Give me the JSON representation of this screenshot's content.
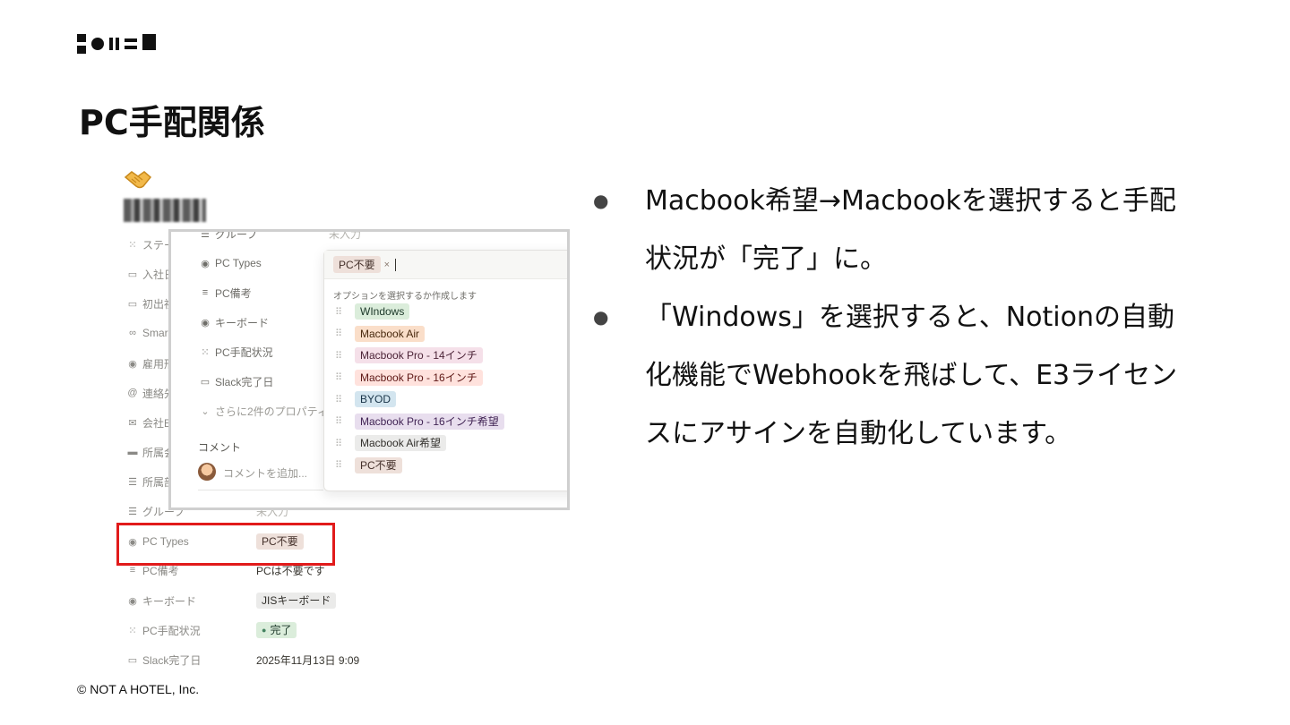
{
  "slide": {
    "title": "PC手配関係",
    "footer": "© NOT A HOTEL, Inc."
  },
  "page_icon": "handshake-icon",
  "background_properties": [
    {
      "icon": "status-icon",
      "label": "ステー"
    },
    {
      "icon": "calendar-icon",
      "label": "入社日"
    },
    {
      "icon": "calendar-icon",
      "label": "初出社"
    },
    {
      "icon": "link-icon",
      "label": "Smar"
    },
    {
      "icon": "select-icon",
      "label": "雇用形"
    },
    {
      "icon": "at-icon",
      "label": "連絡先"
    },
    {
      "icon": "mail-icon",
      "label": "会社E"
    },
    {
      "icon": "briefcase-icon",
      "label": "所属会"
    },
    {
      "icon": "list-icon",
      "label": "所属部"
    },
    {
      "icon": "list-icon",
      "label": "グループ",
      "value": "未入力"
    },
    {
      "icon": "select-icon",
      "label": "PC Types",
      "value": "PC不要"
    },
    {
      "icon": "text-icon",
      "label": "PC備考",
      "value": "PCは不要です"
    },
    {
      "icon": "select-icon",
      "label": "キーボード",
      "value": "JISキーボード"
    },
    {
      "icon": "status-icon",
      "label": "PC手配状況",
      "value": "完了"
    },
    {
      "icon": "calendar-icon",
      "label": "Slack完了日",
      "value": "2025年11月13日 9:09"
    }
  ],
  "popup": {
    "top_row": {
      "label": "グループ",
      "value": "未入力"
    },
    "rows": [
      {
        "icon": "select-icon",
        "label": "PC Types"
      },
      {
        "icon": "text-icon",
        "label": "PC備考"
      },
      {
        "icon": "select-icon",
        "label": "キーボード"
      },
      {
        "icon": "status-icon",
        "label": "PC手配状況"
      },
      {
        "icon": "calendar-icon",
        "label": "Slack完了日"
      }
    ],
    "more_properties": "さらに2件のプロパティ",
    "comments_heading": "コメント",
    "comment_placeholder": "コメントを追加..."
  },
  "dropdown": {
    "selected_chip": "PC不要",
    "chip_remove": "×",
    "hint": "オプションを選択するか作成します",
    "options": [
      {
        "label": "WIndows",
        "bg": "#dbeddb",
        "fg": "#1c3829"
      },
      {
        "label": "Macbook Air",
        "bg": "#fadec9",
        "fg": "#49290e"
      },
      {
        "label": "Macbook Pro - 14インチ",
        "bg": "#f5e0e9",
        "fg": "#4c2337"
      },
      {
        "label": "Macbook Pro - 16インチ",
        "bg": "#ffe2dd",
        "fg": "#5d1715"
      },
      {
        "label": "BYOD",
        "bg": "#d3e5ef",
        "fg": "#183347"
      },
      {
        "label": "Macbook Pro - 16インチ希望",
        "bg": "#e8deee",
        "fg": "#412454"
      },
      {
        "label": "Macbook Air希望",
        "bg": "#ebebea",
        "fg": "#32302c"
      },
      {
        "label": "PC不要",
        "bg": "#eee0da",
        "fg": "#44302a"
      }
    ]
  },
  "bullets": [
    {
      "line1": "Macbook希望→Macbookを選択すると手配",
      "line2": "状況が「完了」に。"
    },
    {
      "line1": "「Windows」を選択すると、Notionの自動",
      "line2": "化機能でWebhookを飛ばして、E3ライセン",
      "line3": "スにアサインを自動化しています。"
    }
  ]
}
